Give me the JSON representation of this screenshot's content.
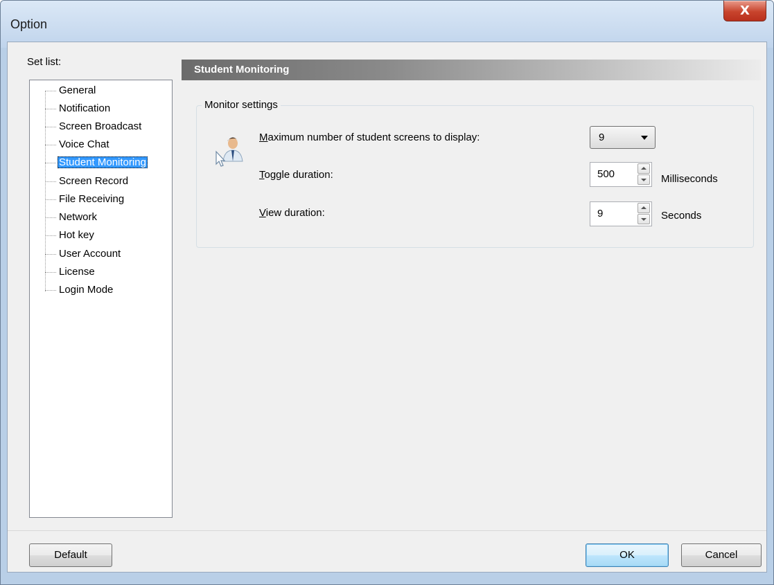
{
  "window": {
    "title": "Option",
    "close_glyph": "X"
  },
  "sidebar": {
    "label": "Set list:",
    "items": [
      {
        "label": "General",
        "selected": false
      },
      {
        "label": "Notification",
        "selected": false
      },
      {
        "label": "Screen Broadcast",
        "selected": false
      },
      {
        "label": "Voice Chat",
        "selected": false
      },
      {
        "label": "Student Monitoring",
        "selected": true
      },
      {
        "label": "Screen Record",
        "selected": false
      },
      {
        "label": "File Receiving",
        "selected": false
      },
      {
        "label": "Network",
        "selected": false
      },
      {
        "label": "Hot key",
        "selected": false
      },
      {
        "label": "User Account",
        "selected": false
      },
      {
        "label": "License",
        "selected": false
      },
      {
        "label": "Login Mode",
        "selected": false
      }
    ]
  },
  "main": {
    "header": "Student Monitoring",
    "group": {
      "title": "Monitor settings",
      "icon": "student-monitor-icon",
      "max_screens": {
        "label_access_key": "M",
        "label_rest": "aximum number of student screens to display:",
        "value": "9"
      },
      "toggle_duration": {
        "label_access_key": "T",
        "label_rest": "oggle duration:",
        "value": "500",
        "unit": "Milliseconds"
      },
      "view_duration": {
        "label_access_key": "V",
        "label_rest": "iew duration:",
        "value": "9",
        "unit": "Seconds"
      }
    }
  },
  "footer": {
    "default_label": "Default",
    "ok_label": "OK",
    "cancel_label": "Cancel"
  },
  "colors": {
    "selection": "#3399ff",
    "titlebar": "#c4d8ee",
    "close_button": "#c8442d"
  }
}
